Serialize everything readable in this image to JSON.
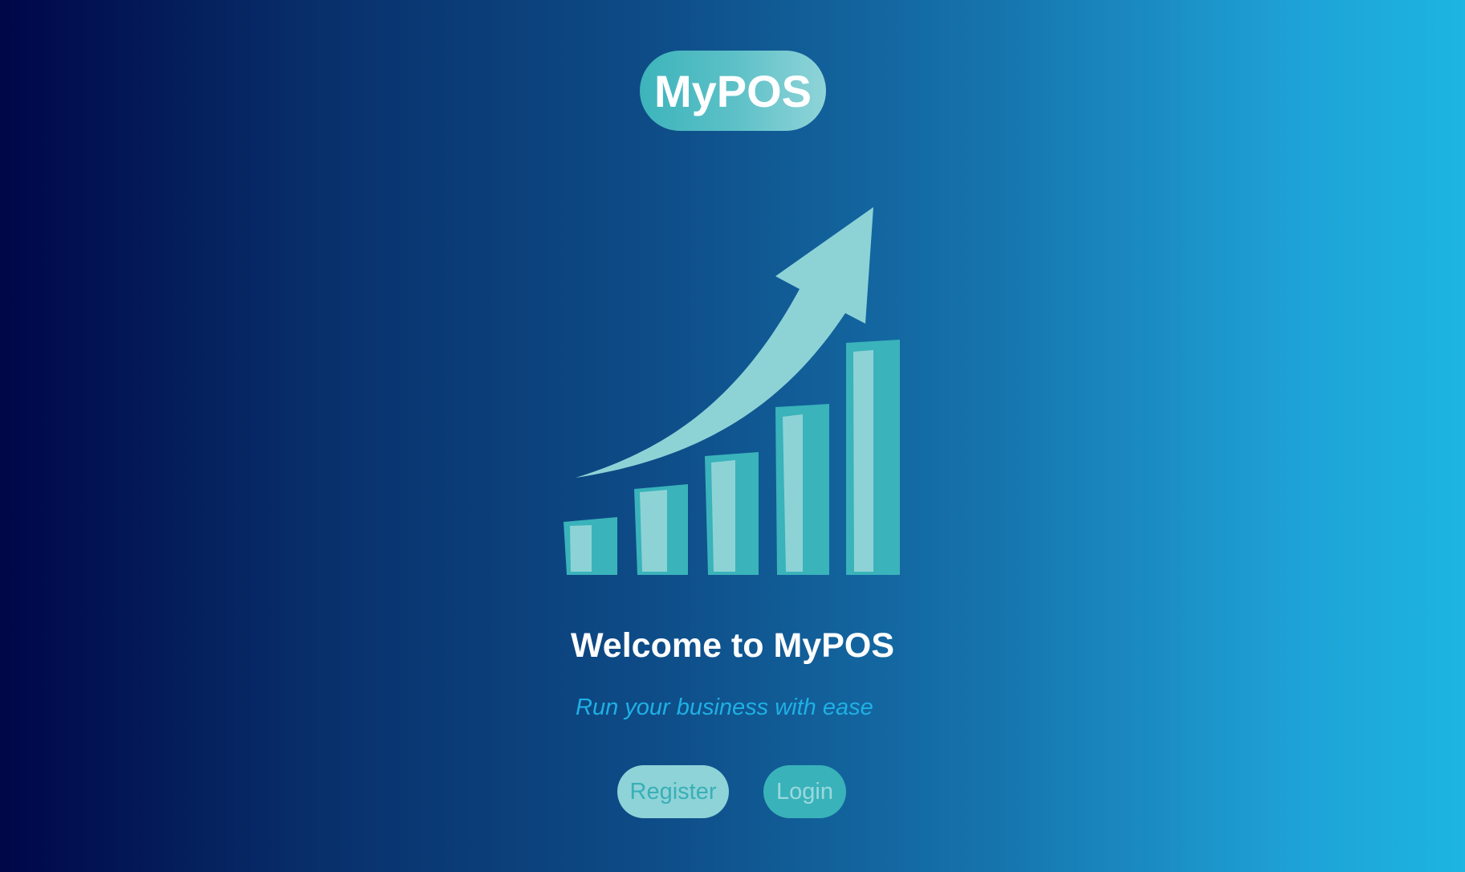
{
  "brand": {
    "logo_text": "MyPOS"
  },
  "hero": {
    "illustration": "growth-bar-chart-with-arrow"
  },
  "welcome": {
    "title": "Welcome to MyPOS",
    "subtitle": "Run your business with ease"
  },
  "actions": {
    "register_label": "Register",
    "login_label": "Login"
  },
  "colors": {
    "background_start": "#000648",
    "background_end": "#1db5e2",
    "accent_teal": "#3ab3bb",
    "accent_light": "#8ed3d7",
    "subtitle": "#1fb0e4",
    "text": "#ffffff"
  }
}
